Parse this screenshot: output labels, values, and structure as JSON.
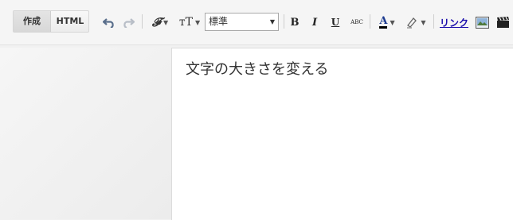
{
  "tabs": {
    "compose": "作成",
    "html": "HTML"
  },
  "toolbar": {
    "undo_icon": "undo-icon",
    "redo_icon": "redo-icon",
    "font_icon_glyph": "𝓕",
    "font_size_icon_glyph": "тT",
    "format_select_value": "標準",
    "bold": "B",
    "italic": "I",
    "underline": "U",
    "strikethrough": "ABC",
    "text_color": "A",
    "link": "リンク"
  },
  "editor": {
    "content": "文字の大きさを変える"
  }
}
